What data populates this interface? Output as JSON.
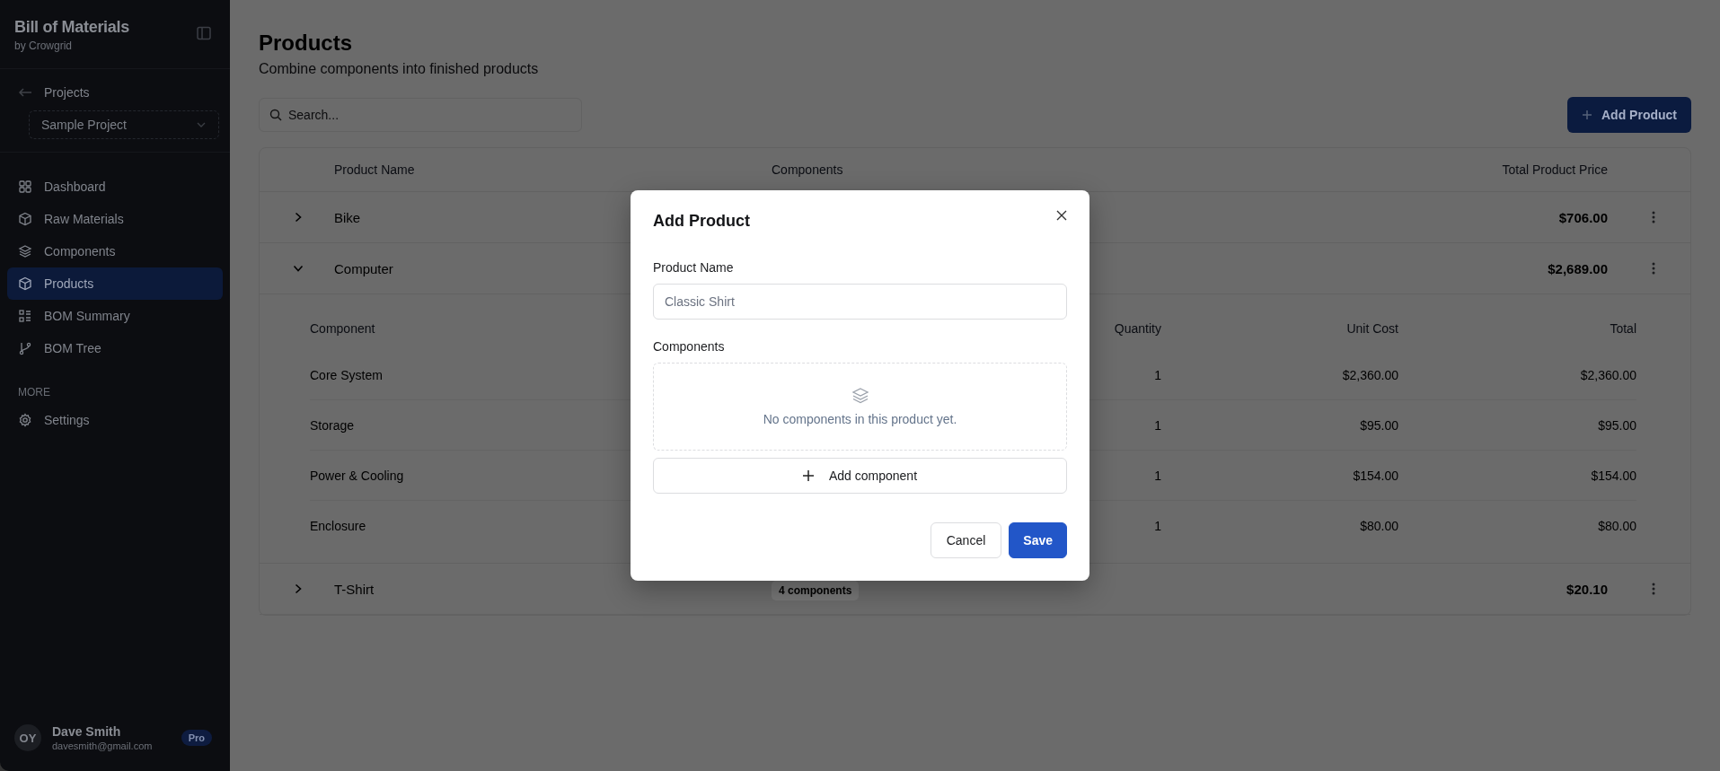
{
  "sidebar": {
    "app_title": "Bill of Materials",
    "app_subtitle": "by Crowgrid",
    "back_link": "Projects",
    "project_select": "Sample Project",
    "nav_items": [
      {
        "label": "Dashboard",
        "selected": false
      },
      {
        "label": "Raw Materials",
        "selected": false
      },
      {
        "label": "Components",
        "selected": false
      },
      {
        "label": "Products",
        "selected": true
      },
      {
        "label": "BOM Summary",
        "selected": false
      },
      {
        "label": "BOM Tree",
        "selected": false
      }
    ],
    "section_label": "MORE",
    "more_items": [
      {
        "label": "Settings",
        "selected": false
      }
    ],
    "user": {
      "initials": "OY",
      "name": "Dave Smith",
      "email": "davesmith@gmail.com",
      "plan": "Pro"
    }
  },
  "page": {
    "title": "Products",
    "subtitle": "Combine components into finished products",
    "search": {
      "placeholder": "Search..."
    },
    "add_button": "Add Product"
  },
  "table": {
    "columns": [
      "Product Name",
      "Components",
      "Total Product Price"
    ],
    "rows": [
      {
        "name": "Bike",
        "expanded": false,
        "total": "$706.00"
      },
      {
        "name": "Computer",
        "expanded": true,
        "total": "$2,689.00",
        "detail": {
          "columns": [
            "Component",
            "Quantity",
            "Unit Cost",
            "Total"
          ],
          "rows": [
            {
              "component": "Core System",
              "quantity": "1",
              "unit_cost": "$2,360.00",
              "total": "$2,360.00"
            },
            {
              "component": "Storage",
              "quantity": "1",
              "unit_cost": "$95.00",
              "total": "$95.00"
            },
            {
              "component": "Power & Cooling",
              "quantity": "1",
              "unit_cost": "$154.00",
              "total": "$154.00"
            },
            {
              "component": "Enclosure",
              "quantity": "1",
              "unit_cost": "$80.00",
              "total": "$80.00"
            }
          ]
        }
      },
      {
        "name": "T-Shirt",
        "expanded": false,
        "components": "4 components",
        "total": "$20.10"
      }
    ]
  },
  "dialog": {
    "title": "Add Product",
    "name_label": "Product Name",
    "name_field": {
      "placeholder": "Classic Shirt"
    },
    "components_label": "Components",
    "empty_message": "No components in this product yet.",
    "add_component_button": "Add component",
    "buttons": [
      {
        "label": "Cancel",
        "kind": "secondary"
      },
      {
        "label": "Save",
        "kind": "primary"
      }
    ]
  }
}
